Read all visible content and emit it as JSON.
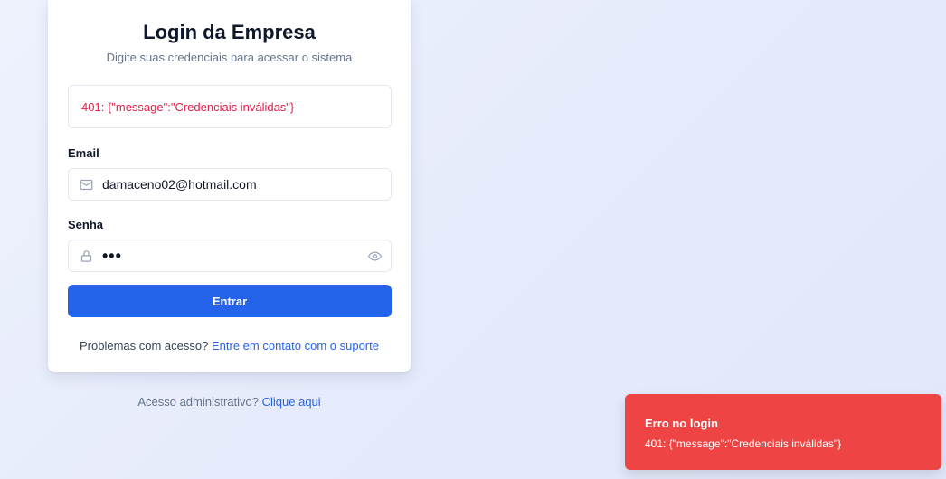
{
  "login": {
    "title": "Login da Empresa",
    "subtitle": "Digite suas credenciais para acessar o sistema",
    "error_message": "401: {\"message\":\"Credenciais inválidas\"}",
    "email_label": "Email",
    "email_value": "damaceno02@hotmail.com",
    "email_icon": "mail-icon",
    "password_label": "Senha",
    "password_value": "•••",
    "password_icon": "lock-icon",
    "password_toggle_icon": "eye-icon",
    "submit_label": "Entrar",
    "help_text": "Problemas com acesso?",
    "help_link": "Entre em contato com o suporte"
  },
  "admin": {
    "text": "Acesso administrativo?",
    "link": "Clique aqui"
  },
  "toast": {
    "title": "Erro no login",
    "message": "401: {\"message\":\"Credenciais inválidas\"}"
  },
  "colors": {
    "primary": "#2563eb",
    "error_text": "#e11d48",
    "toast_bg": "#ef4444"
  }
}
